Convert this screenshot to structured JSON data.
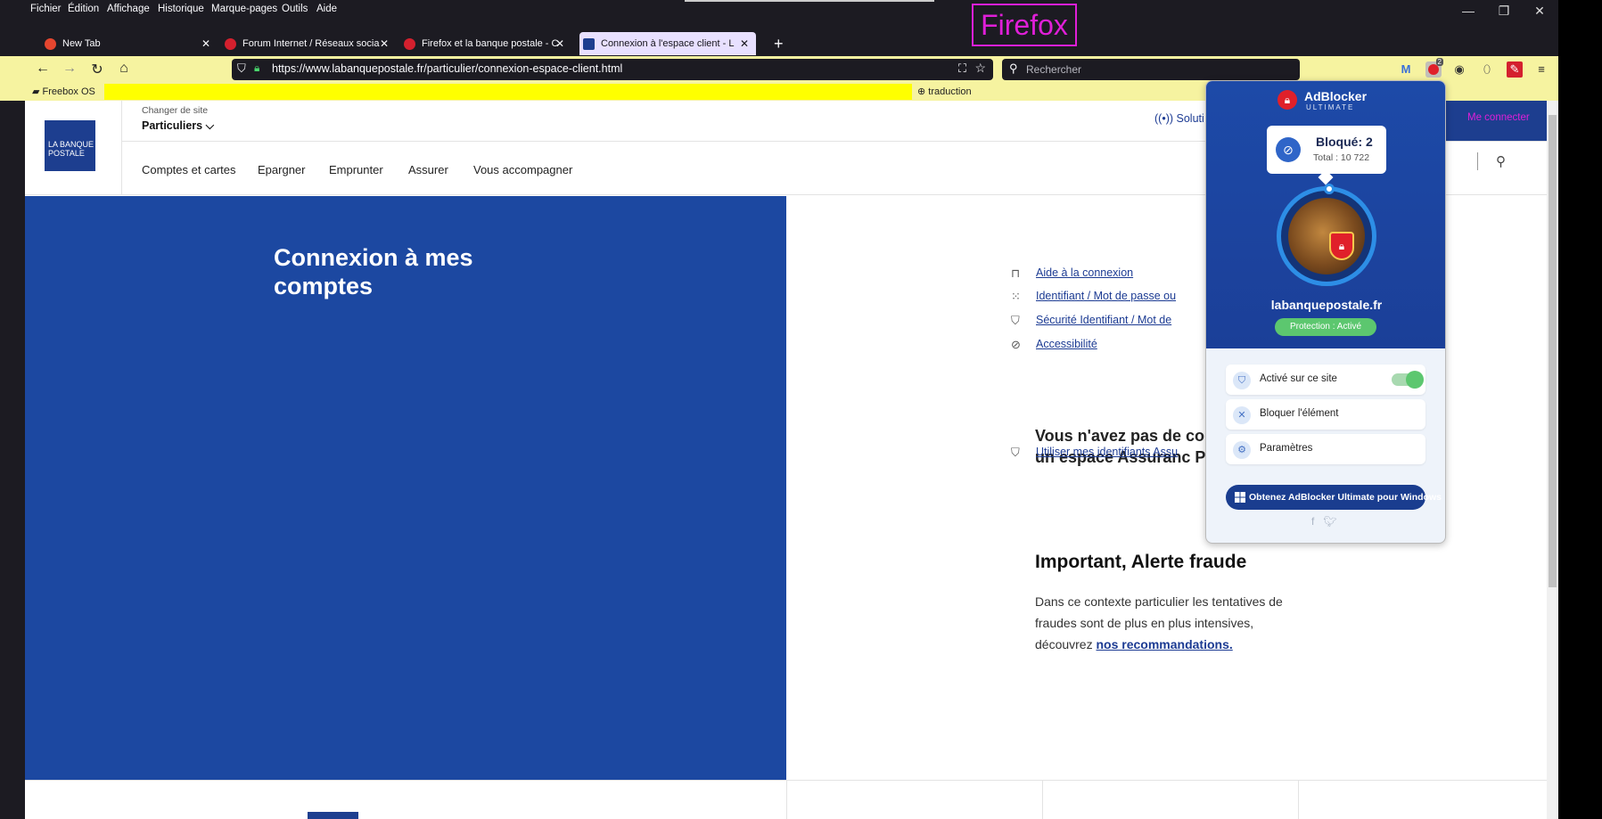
{
  "menu": [
    "Fichier",
    "Édition",
    "Affichage",
    "Historique",
    "Marque-pages",
    "Outils",
    "Aide"
  ],
  "annotation": "Firefox",
  "tabs": [
    {
      "label": "New Tab"
    },
    {
      "label": "Forum Internet / Réseaux socia"
    },
    {
      "label": "Firefox et la banque postale - C"
    },
    {
      "label": "Connexion à l'espace client - L"
    }
  ],
  "url": "https://www.labanquepostale.fr/particulier/connexion-espace-client.html",
  "search_placeholder": "Rechercher",
  "bookmarks": {
    "freebox": "Freebox OS",
    "traduction": "traduction"
  },
  "site": {
    "change_site": "Changer de site",
    "segment": "Particuliers",
    "logo_text": "LA BANQUE POSTALE",
    "nav": [
      "Comptes et cartes",
      "Epargner",
      "Emprunter",
      "Assurer",
      "Vous accompagner"
    ],
    "solutions": "Soluti",
    "connect": "Me connecter",
    "title": "Connexion à mes comptes",
    "links": [
      "Aide à la connexion",
      "Identifiant / Mot de passe ou",
      "Sécurité Identifiant / Mot de",
      "Accessibilité"
    ],
    "question": "Vous n'avez pas de comp mais un espace Assuranc Postale ?",
    "use_ids": "Utiliser mes identifiants Assu",
    "alert_title": "Important, Alerte fraude",
    "alert_body": "Dans ce contexte particulier les tentatives de fraudes sont de plus en plus intensives, découvrez ",
    "alert_link": "nos recommandations."
  },
  "popup": {
    "brand": "AdBlocker",
    "brand_sub": "ULTIMATE",
    "blocked": "Bloqué: 2",
    "total": "Total : 10 722",
    "domain": "labanquepostale.fr",
    "status": "Protection : Activé",
    "rows": [
      "Activé sur ce site",
      "Bloquer l'élément",
      "Paramètres"
    ],
    "windows_btn": "Obtenez AdBlocker Ultimate pour Windows",
    "badge": "2"
  }
}
